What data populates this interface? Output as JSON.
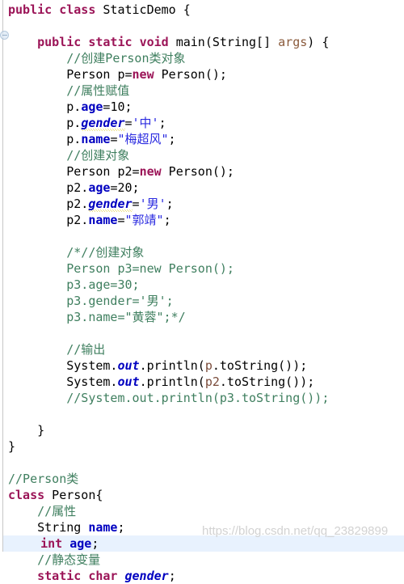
{
  "editor": {
    "language": "java",
    "background": "#ffffff",
    "current_line_highlight": "#e8f2fe",
    "colors": {
      "keyword": "#9b1457",
      "comment": "#3f7f5f",
      "string": "#2a2ae0",
      "field": "#0000c0",
      "parameter": "#8a5a3b",
      "plain": "#000000",
      "warning_underline": "#d8c200"
    },
    "gutter": {
      "icon_name": "override-marker-icon"
    },
    "watermark": "https://blog.csdn.net/qq_23829899"
  },
  "code": {
    "lines": [
      {
        "n": 1,
        "indent": 0,
        "current": false,
        "tokens": [
          {
            "t": "public",
            "c": "kw"
          },
          {
            "t": " ",
            "c": "plain"
          },
          {
            "t": "class",
            "c": "kw"
          },
          {
            "t": " StaticDemo {",
            "c": "plain"
          }
        ]
      },
      {
        "n": 2,
        "indent": 0,
        "current": false,
        "tokens": []
      },
      {
        "n": 3,
        "indent": 0,
        "current": false,
        "tokens": [
          {
            "t": "    ",
            "c": "plain"
          },
          {
            "t": "public",
            "c": "kw"
          },
          {
            "t": " ",
            "c": "plain"
          },
          {
            "t": "static",
            "c": "kw"
          },
          {
            "t": " ",
            "c": "plain"
          },
          {
            "t": "void",
            "c": "kw"
          },
          {
            "t": " main(String[] ",
            "c": "plain"
          },
          {
            "t": "args",
            "c": "param"
          },
          {
            "t": ") {",
            "c": "plain"
          }
        ]
      },
      {
        "n": 4,
        "indent": 0,
        "current": false,
        "tokens": [
          {
            "t": "        //创建Person类对象",
            "c": "cmt"
          }
        ]
      },
      {
        "n": 5,
        "indent": 0,
        "current": false,
        "tokens": [
          {
            "t": "        Person p=",
            "c": "plain"
          },
          {
            "t": "new",
            "c": "kw"
          },
          {
            "t": " Person();",
            "c": "plain"
          }
        ]
      },
      {
        "n": 6,
        "indent": 0,
        "current": false,
        "tokens": [
          {
            "t": "        //属性赋值",
            "c": "cmt"
          }
        ]
      },
      {
        "n": 7,
        "indent": 0,
        "current": false,
        "tokens": [
          {
            "t": "        p.",
            "c": "plain"
          },
          {
            "t": "age",
            "c": "fld"
          },
          {
            "t": "=",
            "c": "plain"
          },
          {
            "t": "10",
            "c": "plain"
          },
          {
            "t": ";",
            "c": "plain"
          }
        ]
      },
      {
        "n": 8,
        "indent": 0,
        "current": false,
        "tokens": [
          {
            "t": "        p.",
            "c": "plain"
          },
          {
            "t": "gender",
            "c": "fldi warn"
          },
          {
            "t": "=",
            "c": "plain"
          },
          {
            "t": "'中'",
            "c": "str"
          },
          {
            "t": ";",
            "c": "plain"
          }
        ]
      },
      {
        "n": 9,
        "indent": 0,
        "current": false,
        "tokens": [
          {
            "t": "        p.",
            "c": "plain"
          },
          {
            "t": "name",
            "c": "fld"
          },
          {
            "t": "=",
            "c": "plain"
          },
          {
            "t": "\"梅超风\"",
            "c": "str"
          },
          {
            "t": ";",
            "c": "plain"
          }
        ]
      },
      {
        "n": 10,
        "indent": 0,
        "current": false,
        "tokens": [
          {
            "t": "        //创建对象",
            "c": "cmt"
          }
        ]
      },
      {
        "n": 11,
        "indent": 0,
        "current": false,
        "tokens": [
          {
            "t": "        Person p2=",
            "c": "plain"
          },
          {
            "t": "new",
            "c": "kw"
          },
          {
            "t": " Person();",
            "c": "plain"
          }
        ]
      },
      {
        "n": 12,
        "indent": 0,
        "current": false,
        "tokens": [
          {
            "t": "        p2.",
            "c": "plain"
          },
          {
            "t": "age",
            "c": "fld"
          },
          {
            "t": "=",
            "c": "plain"
          },
          {
            "t": "20",
            "c": "plain"
          },
          {
            "t": ";",
            "c": "plain"
          }
        ]
      },
      {
        "n": 13,
        "indent": 0,
        "current": false,
        "tokens": [
          {
            "t": "        p2.",
            "c": "plain"
          },
          {
            "t": "gender",
            "c": "fldi warn"
          },
          {
            "t": "=",
            "c": "plain"
          },
          {
            "t": "'男'",
            "c": "str"
          },
          {
            "t": ";",
            "c": "plain"
          }
        ]
      },
      {
        "n": 14,
        "indent": 0,
        "current": false,
        "tokens": [
          {
            "t": "        p2.",
            "c": "plain"
          },
          {
            "t": "name",
            "c": "fld"
          },
          {
            "t": "=",
            "c": "plain"
          },
          {
            "t": "\"郭靖\"",
            "c": "str"
          },
          {
            "t": ";",
            "c": "plain"
          }
        ]
      },
      {
        "n": 15,
        "indent": 0,
        "current": false,
        "tokens": []
      },
      {
        "n": 16,
        "indent": 0,
        "current": false,
        "tokens": [
          {
            "t": "        /*//创建对象",
            "c": "cmt"
          }
        ]
      },
      {
        "n": 17,
        "indent": 0,
        "current": false,
        "tokens": [
          {
            "t": "        Person p3=new Person();",
            "c": "cmt"
          }
        ]
      },
      {
        "n": 18,
        "indent": 0,
        "current": false,
        "tokens": [
          {
            "t": "        p3.age=30;",
            "c": "cmt"
          }
        ]
      },
      {
        "n": 19,
        "indent": 0,
        "current": false,
        "tokens": [
          {
            "t": "        p3.gender='男';",
            "c": "cmt"
          }
        ]
      },
      {
        "n": 20,
        "indent": 0,
        "current": false,
        "tokens": [
          {
            "t": "        p3.name=\"黄蓉\";*/",
            "c": "cmt"
          }
        ]
      },
      {
        "n": 21,
        "indent": 0,
        "current": false,
        "tokens": []
      },
      {
        "n": 22,
        "indent": 0,
        "current": false,
        "tokens": [
          {
            "t": "        //输出",
            "c": "cmt"
          }
        ]
      },
      {
        "n": 23,
        "indent": 0,
        "current": false,
        "tokens": [
          {
            "t": "        System.",
            "c": "plain"
          },
          {
            "t": "out",
            "c": "fldi"
          },
          {
            "t": ".println(",
            "c": "plain"
          },
          {
            "t": "p",
            "c": "var"
          },
          {
            "t": ".toString());",
            "c": "plain"
          }
        ]
      },
      {
        "n": 24,
        "indent": 0,
        "current": false,
        "tokens": [
          {
            "t": "        System.",
            "c": "plain"
          },
          {
            "t": "out",
            "c": "fldi"
          },
          {
            "t": ".println(",
            "c": "plain"
          },
          {
            "t": "p2",
            "c": "var"
          },
          {
            "t": ".toString());",
            "c": "plain"
          }
        ]
      },
      {
        "n": 25,
        "indent": 0,
        "current": false,
        "tokens": [
          {
            "t": "        //System.out.println(p3.toString());",
            "c": "cmt"
          }
        ]
      },
      {
        "n": 26,
        "indent": 0,
        "current": false,
        "tokens": []
      },
      {
        "n": 27,
        "indent": 0,
        "current": false,
        "tokens": [
          {
            "t": "    }",
            "c": "plain"
          }
        ]
      },
      {
        "n": 28,
        "indent": 0,
        "current": false,
        "tokens": [
          {
            "t": "}",
            "c": "plain"
          }
        ]
      },
      {
        "n": 29,
        "indent": 0,
        "current": false,
        "tokens": []
      },
      {
        "n": 30,
        "indent": 0,
        "current": false,
        "tokens": [
          {
            "t": "//Person类",
            "c": "cmt"
          }
        ]
      },
      {
        "n": 31,
        "indent": 0,
        "current": false,
        "tokens": [
          {
            "t": "class",
            "c": "kw"
          },
          {
            "t": " Person{",
            "c": "plain"
          }
        ]
      },
      {
        "n": 32,
        "indent": 0,
        "current": false,
        "tokens": [
          {
            "t": "    //属性",
            "c": "cmt"
          }
        ]
      },
      {
        "n": 33,
        "indent": 0,
        "current": false,
        "tokens": [
          {
            "t": "    String ",
            "c": "plain"
          },
          {
            "t": "name",
            "c": "fld"
          },
          {
            "t": ";",
            "c": "plain"
          }
        ]
      },
      {
        "n": 34,
        "indent": 0,
        "current": true,
        "tokens": [
          {
            "t": "    ",
            "c": "plain"
          },
          {
            "t": "int",
            "c": "kw"
          },
          {
            "t": " ",
            "c": "plain"
          },
          {
            "t": "age",
            "c": "fld"
          },
          {
            "t": ";",
            "c": "plain"
          }
        ]
      },
      {
        "n": 35,
        "indent": 0,
        "current": false,
        "tokens": [
          {
            "t": "    //静态变量",
            "c": "cmt"
          }
        ]
      },
      {
        "n": 36,
        "indent": 0,
        "current": false,
        "tokens": [
          {
            "t": "    ",
            "c": "plain"
          },
          {
            "t": "static",
            "c": "kw"
          },
          {
            "t": " ",
            "c": "plain"
          },
          {
            "t": "char",
            "c": "kw"
          },
          {
            "t": " ",
            "c": "plain"
          },
          {
            "t": "gender",
            "c": "fldi"
          },
          {
            "t": ";",
            "c": "plain"
          }
        ]
      }
    ]
  }
}
